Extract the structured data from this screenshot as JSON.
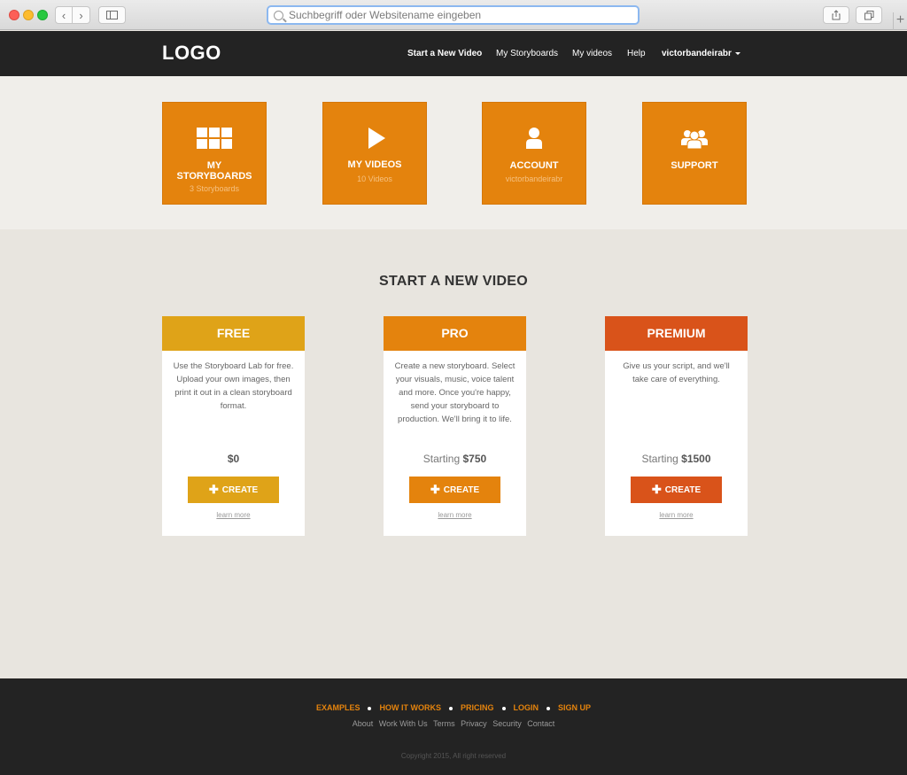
{
  "browser": {
    "address_placeholder": "Suchbegriff oder Websitename eingeben",
    "new_tab": "+"
  },
  "header": {
    "logo": "LOGO",
    "nav": {
      "start": "Start a New Video",
      "storyboards": "My Storyboards",
      "videos": "My videos",
      "help": "Help",
      "user": "victorbandeirabr"
    }
  },
  "tiles": [
    {
      "label": "MY STORYBOARDS",
      "sub": "3 Storyboards",
      "icon": "grid-icon"
    },
    {
      "label": "MY VIDEOS",
      "sub": "10 Videos",
      "icon": "play-icon"
    },
    {
      "label": "ACCOUNT",
      "sub": "victorbandeirabr",
      "icon": "user-icon"
    },
    {
      "label": "SUPPORT",
      "sub": "",
      "icon": "users-icon"
    }
  ],
  "start": {
    "title": "START A NEW VIDEO",
    "plans": [
      {
        "name": "FREE",
        "color": "#dfa318",
        "description": "Use the Storyboard Lab for free. Upload your own images, then print it out in a clean storyboard format.",
        "price_prefix": "",
        "price": "$0",
        "cta": "CREATE",
        "learn": "learn more"
      },
      {
        "name": "PRO",
        "color": "#e4830d",
        "description": "Create a new storyboard. Select your visuals, music, voice talent and more. Once you're happy, send your storyboard to production. We'll bring it to life.",
        "price_prefix": "Starting",
        "price": "$750",
        "cta": "CREATE",
        "learn": "learn more"
      },
      {
        "name": "PREMIUM",
        "color": "#d9531a",
        "description": "Give us your script, and we'll take care of everything.",
        "price_prefix": "Starting",
        "price": "$1500",
        "cta": "CREATE",
        "learn": "learn more"
      }
    ]
  },
  "footer": {
    "links": [
      "EXAMPLES",
      "HOW IT WORKS",
      "PRICING",
      "LOGIN",
      "SIGN UP"
    ],
    "sub_links": [
      "About",
      "Work With Us",
      "Terms",
      "Privacy",
      "Security",
      "Contact"
    ],
    "copyright": "Copyright 2015, All right reserved"
  },
  "colors": {
    "accent": "#e4830d",
    "header_bg": "#232323"
  }
}
